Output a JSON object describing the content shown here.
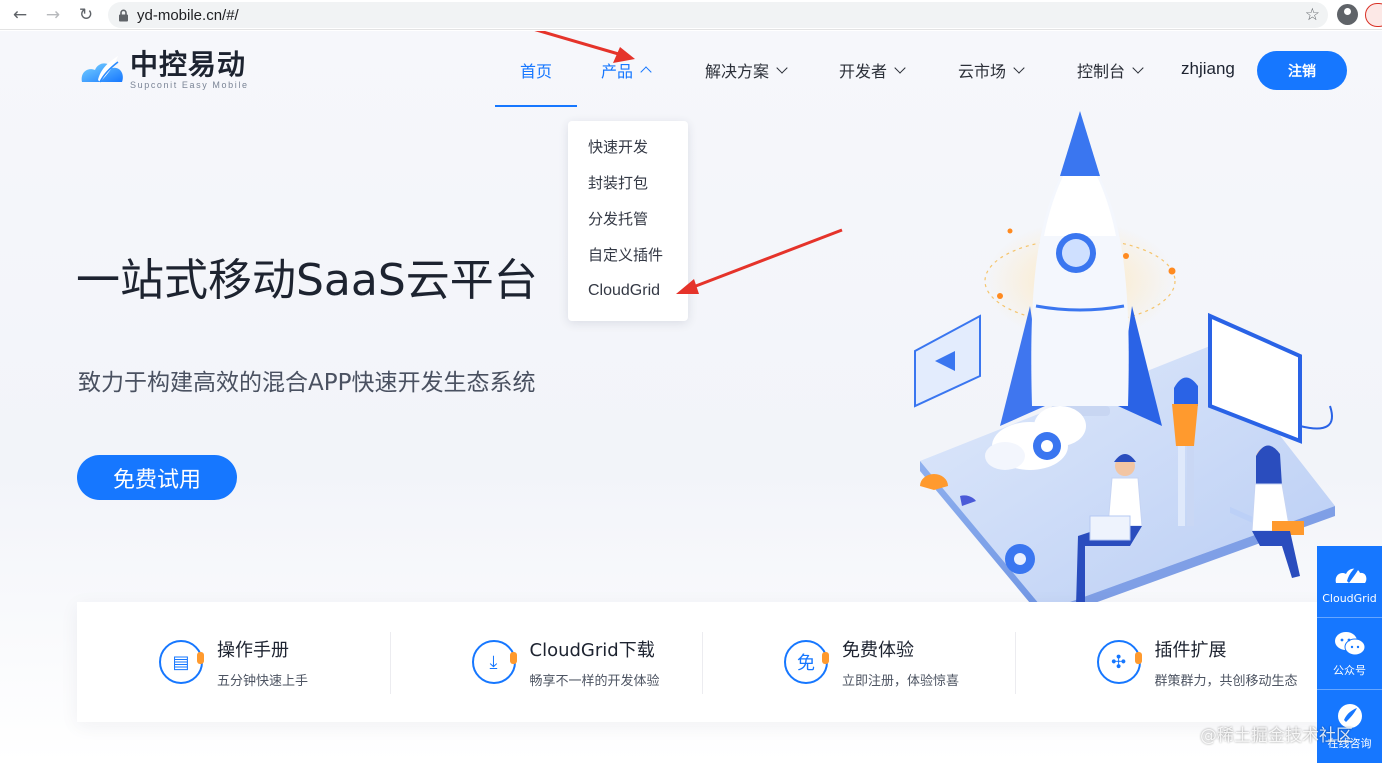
{
  "browser": {
    "url": "yd-mobile.cn/#/"
  },
  "header": {
    "logo_cn": "中控易动",
    "logo_en": "Supconit Easy Mobile",
    "nav": [
      {
        "label": "首页",
        "active": true
      },
      {
        "label": "产品",
        "open": true
      },
      {
        "label": "解决方案"
      },
      {
        "label": "开发者"
      },
      {
        "label": "云市场"
      },
      {
        "label": "控制台"
      }
    ],
    "user": "zhjiang",
    "logout_label": "注销"
  },
  "dropdown": {
    "items": [
      "快速开发",
      "封装打包",
      "分发托管",
      "自定义插件",
      "CloudGrid"
    ]
  },
  "hero": {
    "title": "一站式移动SaaS云平台",
    "subtitle": "致力于构建高效的混合APP快速开发生态系统",
    "cta": "免费试用"
  },
  "features": [
    {
      "title": "操作手册",
      "desc": "五分钟快速上手",
      "icon": "book-icon"
    },
    {
      "title": "CloudGrid下载",
      "desc": "畅享不一样的开发体验",
      "icon": "download-icon"
    },
    {
      "title": "免费体验",
      "desc": "立即注册，体验惊喜",
      "icon": "free-icon",
      "glyph": "免"
    },
    {
      "title": "插件扩展",
      "desc": "群策群力，共创移动生态",
      "icon": "puzzle-icon"
    }
  ],
  "sidebar": {
    "items": [
      {
        "label": "CloudGrid",
        "icon": "cloudgrid-icon"
      },
      {
        "label": "公众号",
        "icon": "wechat-icon"
      },
      {
        "label": "在线咨询",
        "icon": "chat-icon"
      }
    ]
  },
  "watermark": "@稀土掘金技术社区",
  "colors": {
    "brand": "#1677ff",
    "annotation": "#e5332a"
  }
}
